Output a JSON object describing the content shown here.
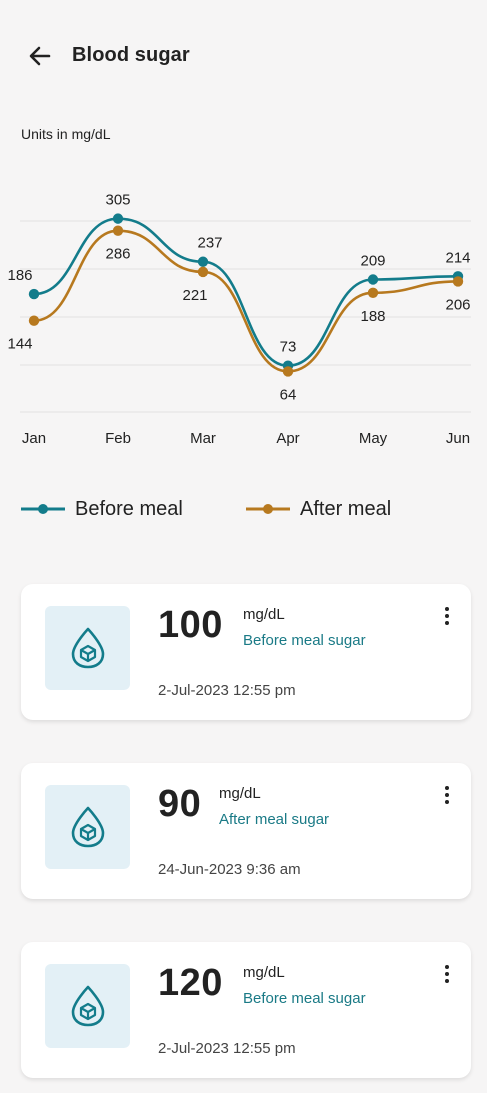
{
  "header": {
    "title": "Blood sugar",
    "back_icon": "arrow-left-icon"
  },
  "units_label": "Units in mg/dL",
  "colors": {
    "before": "#137c8b",
    "after": "#b7791f",
    "accent_text": "#1a7a86",
    "tile_bg": "#e3f0f6"
  },
  "chart_data": {
    "type": "line",
    "categories": [
      "Jan",
      "Feb",
      "Mar",
      "Apr",
      "May",
      "Jun"
    ],
    "series": [
      {
        "name": "Before meal",
        "values": [
          186,
          305,
          237,
          73,
          209,
          214
        ]
      },
      {
        "name": "After meal",
        "values": [
          144,
          286,
          221,
          64,
          188,
          206
        ]
      }
    ],
    "ylim": [
      0,
      360
    ],
    "grid": true,
    "legend": "bottom-left"
  },
  "legend": [
    {
      "label": "Before meal"
    },
    {
      "label": "After meal"
    }
  ],
  "readings": [
    {
      "value": "100",
      "unit": "mg/dL",
      "type": "Before meal sugar",
      "datetime": "2-Jul-2023  12:55 pm",
      "icon": "blood-drop-icon"
    },
    {
      "value": "90",
      "unit": "mg/dL",
      "type": "After meal sugar",
      "datetime": "24-Jun-2023  9:36 am",
      "icon": "blood-drop-icon"
    },
    {
      "value": "120",
      "unit": "mg/dL",
      "type": "Before meal sugar",
      "datetime": "2-Jul-2023  12:55 pm",
      "icon": "blood-drop-icon"
    }
  ]
}
